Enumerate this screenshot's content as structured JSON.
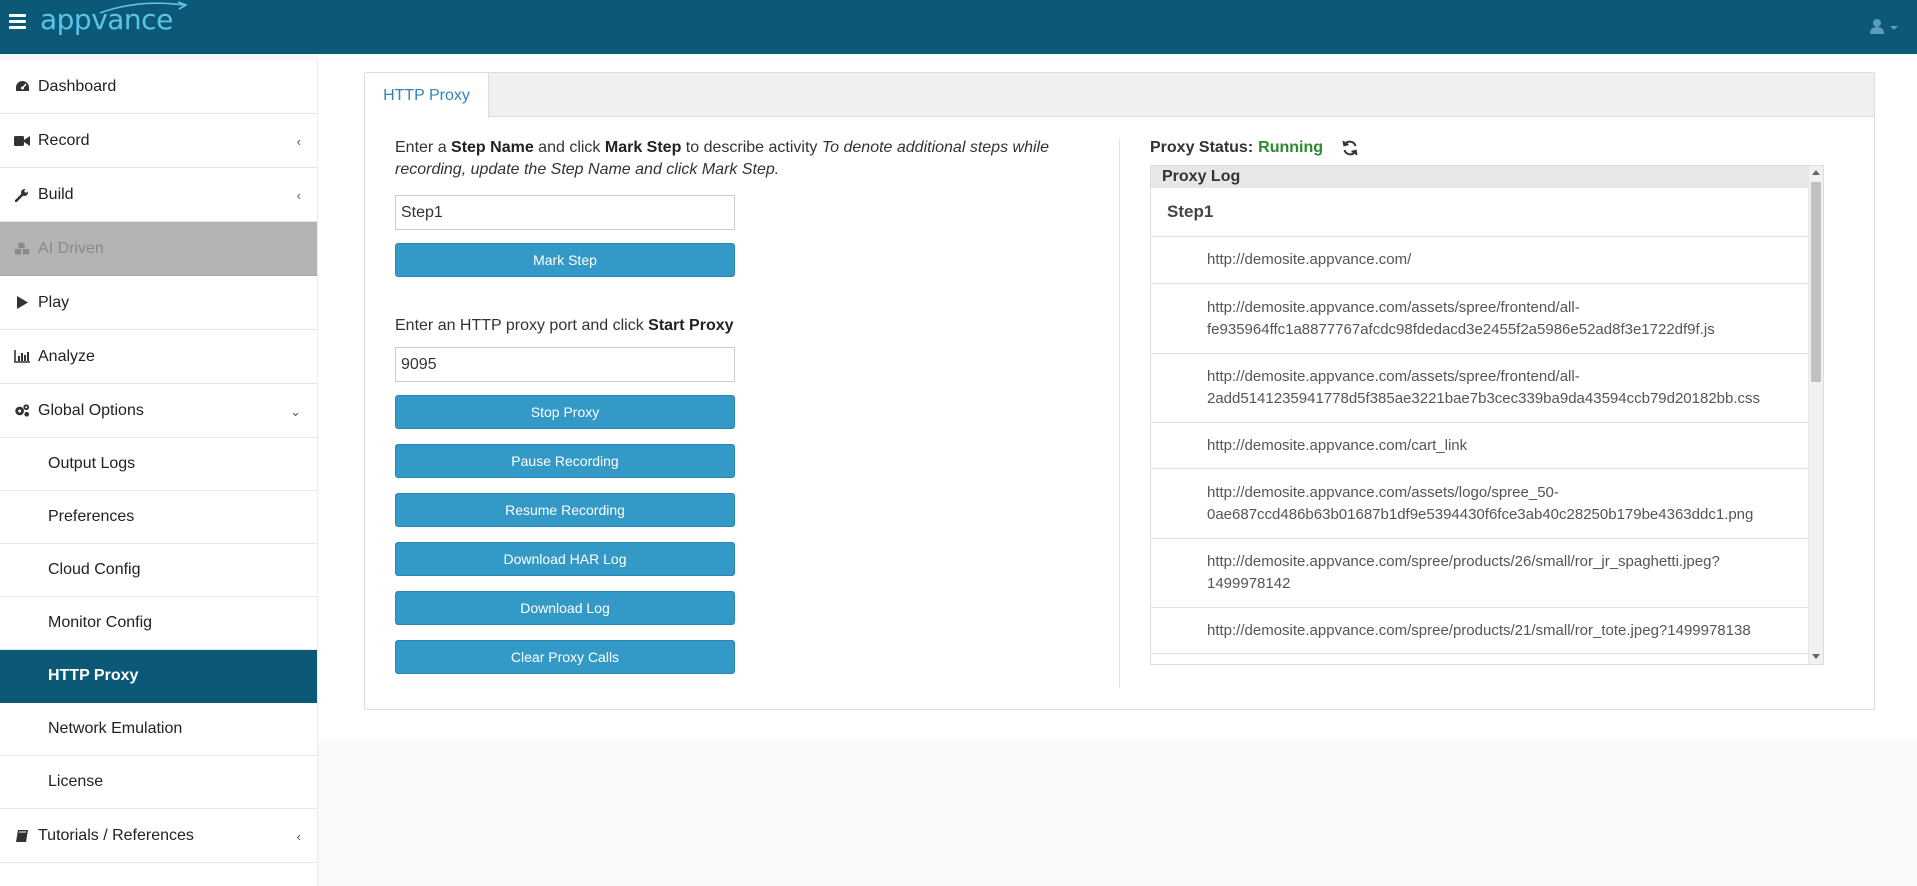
{
  "app": {
    "logo_text": "appvance",
    "brand_color": "#0b5877",
    "accent_color": "#3399c6"
  },
  "sidebar": {
    "items": [
      {
        "label": "Dashboard",
        "icon": "dashboard-icon"
      },
      {
        "label": "Record",
        "icon": "video-camera-icon",
        "chevron": "‹"
      },
      {
        "label": "Build",
        "icon": "wrench-icon",
        "chevron": "‹"
      },
      {
        "label": "AI Driven",
        "icon": "cubes-icon",
        "disabled": true
      },
      {
        "label": "Play",
        "icon": "play-icon"
      },
      {
        "label": "Analyze",
        "icon": "bar-chart-icon"
      },
      {
        "label": "Global Options",
        "icon": "gears-icon",
        "chevron": "⌄"
      }
    ],
    "sub_items": [
      {
        "label": "Output Logs"
      },
      {
        "label": "Preferences"
      },
      {
        "label": "Cloud Config"
      },
      {
        "label": "Monitor Config"
      },
      {
        "label": "HTTP Proxy",
        "active": true
      },
      {
        "label": "Network Emulation"
      },
      {
        "label": "License"
      }
    ],
    "footer_item": {
      "label": "Tutorials / References",
      "icon": "book-icon",
      "chevron": "‹"
    }
  },
  "main": {
    "tab_label": "HTTP Proxy",
    "intro": {
      "part1": "Enter a ",
      "bold1": "Step Name",
      "part2": " and click ",
      "bold2": "Mark Step",
      "part3": " to describe activity ",
      "italic": "To denote additional steps while recording, update the Step Name and click Mark Step."
    },
    "step_name_value": "Step1",
    "mark_step_label": "Mark Step",
    "port_prompt": {
      "text": "Enter an HTTP proxy port and click ",
      "bold": "Start Proxy"
    },
    "port_value": "9095",
    "buttons": {
      "stop_proxy": "Stop Proxy",
      "pause_recording": "Pause Recording",
      "resume_recording": "Resume Recording",
      "download_har": "Download HAR Log",
      "download_log": "Download Log",
      "clear_proxy_calls": "Clear Proxy Calls"
    },
    "proxy_status": {
      "label": "Proxy Status:",
      "value": "Running",
      "value_color": "#2d8a2d"
    },
    "proxy_log": {
      "header": "Proxy Log",
      "step": "Step1",
      "entries": [
        "http://demosite.appvance.com/",
        "http://demosite.appvance.com/assets/spree/frontend/all-fe935964ffc1a8877767afcdc98fdedacd3e2455f2a5986e52ad8f3e1722df9f.js",
        "http://demosite.appvance.com/assets/spree/frontend/all-2add5141235941778d5f385ae3221bae7b3cec339ba9da43594ccb79d20182bb.css",
        "http://demosite.appvance.com/cart_link",
        "http://demosite.appvance.com/assets/logo/spree_50-0ae687ccd486b63b01687b1df9e5394430f6fce3ab40c28250b179be4363ddc1.png",
        "http://demosite.appvance.com/spree/products/26/small/ror_jr_spaghetti.jpeg?1499978142",
        "http://demosite.appvance.com/spree/products/21/small/ror_tote.jpeg?1499978138"
      ]
    }
  }
}
